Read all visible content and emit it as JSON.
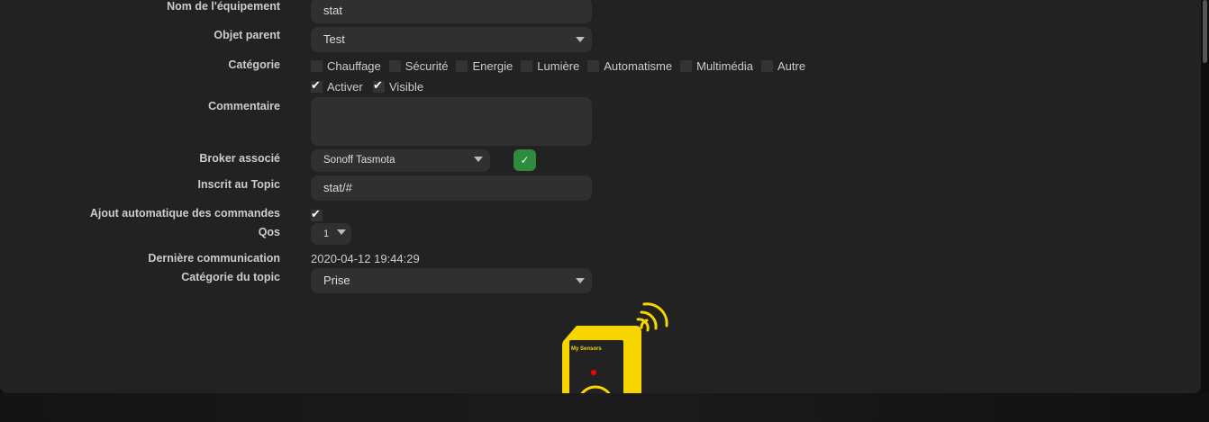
{
  "form": {
    "name": {
      "label": "Nom de l'équipement",
      "value": "stat"
    },
    "parent": {
      "label": "Objet parent",
      "value": "Test"
    },
    "category": {
      "label": "Catégorie",
      "options": [
        "Chauffage",
        "Sécurité",
        "Energie",
        "Lumière",
        "Automatisme",
        "Multimédia",
        "Autre"
      ]
    },
    "activate": "Activer",
    "visible": "Visible",
    "comment": {
      "label": "Commentaire",
      "value": ""
    },
    "broker": {
      "label": "Broker associé",
      "value": "Sonoff Tasmota"
    },
    "topic": {
      "label": "Inscrit au Topic",
      "value": "stat/#"
    },
    "auto": {
      "label": "Ajout automatique des commandes"
    },
    "qos": {
      "label": "Qos",
      "value": "1"
    },
    "last": {
      "label": "Dernière communication",
      "value": "2020-04-12 19:44:29"
    },
    "topic_cat": {
      "label": "Catégorie du topic",
      "value": "Prise"
    }
  },
  "image": {
    "text": "My Sensors"
  },
  "colors": {
    "accent": "#2e8b3e",
    "yellow": "#f7d600"
  }
}
